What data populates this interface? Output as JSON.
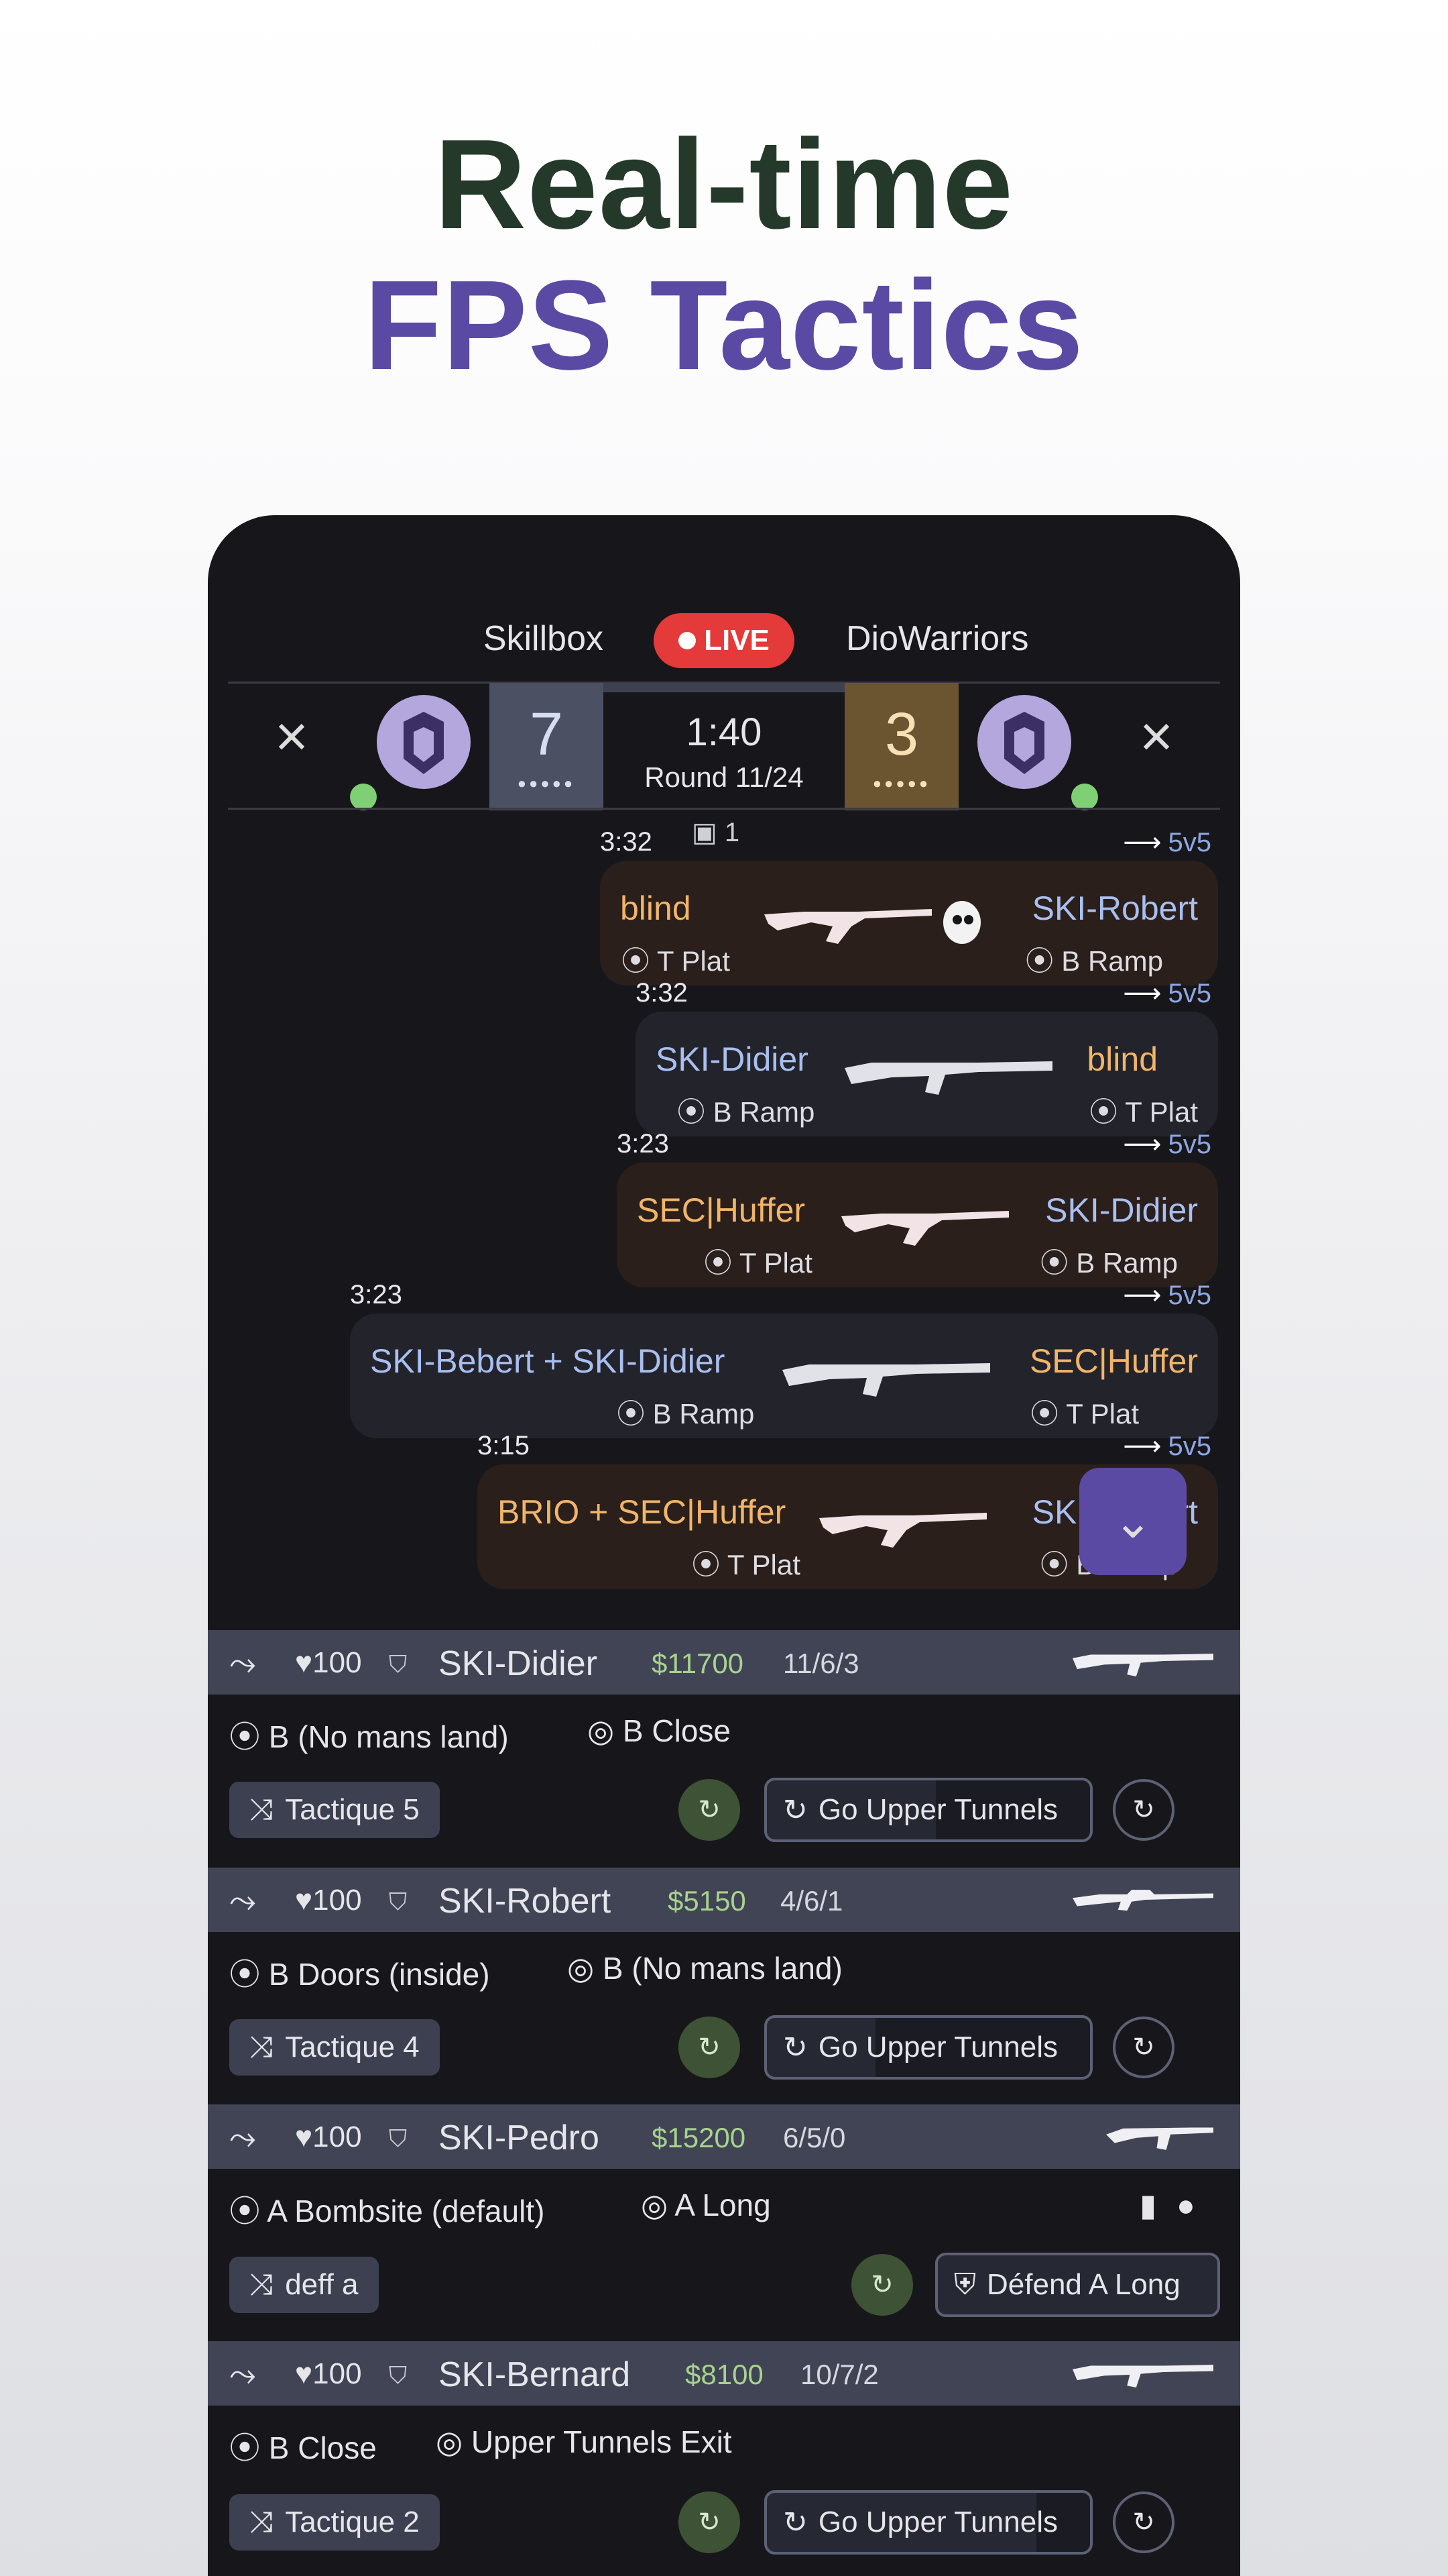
{
  "hero": {
    "line1": "Real-time",
    "line2": "FPS Tactics"
  },
  "match": {
    "team_left": "Skillbox",
    "team_right": "DioWarriors",
    "live_label": "LIVE",
    "score_left": "7",
    "score_right": "3",
    "clock": "1:40",
    "round": "Round 11/24",
    "spectators": "1"
  },
  "killfeed": [
    {
      "time": "3:32",
      "tag": "5v5",
      "killer": "blind",
      "killer_loc": "T Plat",
      "victim": "SKI-Robert",
      "victim_loc": "B Ramp"
    },
    {
      "time": "3:32",
      "tag": "5v5",
      "killer": "SKI-Didier",
      "killer_loc": "B Ramp",
      "victim": "blind",
      "victim_loc": "T Plat"
    },
    {
      "time": "3:23",
      "tag": "5v5",
      "killer": "SEC|Huffer",
      "killer_loc": "T Plat",
      "victim": "SKI-Didier",
      "victim_loc": "B Ramp"
    },
    {
      "time": "3:23",
      "tag": "5v5",
      "killer": "SKI-Bebert + SKI-Didier",
      "killer_loc": "B Ramp",
      "victim": "SEC|Huffer",
      "victim_loc": "T Plat"
    },
    {
      "time": "3:15",
      "tag": "5v5",
      "killer": "BRIO + SEC|Huffer",
      "killer_loc": "T Plat",
      "victim": "SKI-Robert",
      "victim_loc": "B Ramp"
    }
  ],
  "players": [
    {
      "health": "100",
      "name": "SKI-Didier",
      "money": "$11700",
      "kda": "11/6/3",
      "position": "B (No mans land)",
      "target": "B Close",
      "tactic": "Tactique 5",
      "action": "Go Upper Tunnels"
    },
    {
      "health": "100",
      "name": "SKI-Robert",
      "money": "$5150",
      "kda": "4/6/1",
      "position": "B Doors (inside)",
      "target": "B (No mans land)",
      "tactic": "Tactique 4",
      "action": "Go Upper Tunnels"
    },
    {
      "health": "100",
      "name": "SKI-Pedro",
      "money": "$15200",
      "kda": "6/5/0",
      "position": "A Bombsite (default)",
      "target": "A Long",
      "tactic": "deff a",
      "action": "Défend A Long"
    },
    {
      "health": "100",
      "name": "SKI-Bernard",
      "money": "$8100",
      "kda": "10/7/2",
      "position": "B Close",
      "target": "Upper Tunnels Exit",
      "tactic": "Tactique 2",
      "action": "Go Upper Tunnels"
    }
  ],
  "colors": {
    "brand": "#5b4aa4",
    "live": "#e43a3a",
    "t_side": "#f1b56a",
    "ct_side": "#a9bff0",
    "money": "#a7d38e"
  }
}
